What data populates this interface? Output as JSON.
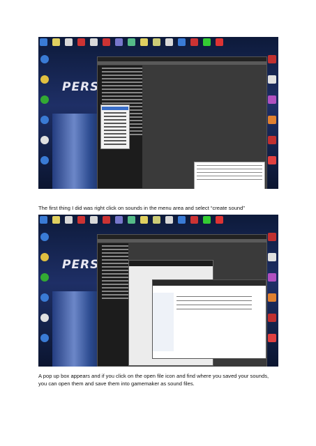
{
  "captions": {
    "first": "The first thing I did was right click on sounds in the menu area and select “create sound”",
    "second_line1": "A pop up box appears and if you click on the open file icon and find where you saved your sounds,",
    "second_line2": "you can open them and save them into gamemaker as sound files."
  },
  "screenshots": [
    {
      "name": "right-click-create-sound",
      "description_tag": "desktop-with-gamemaker-context-menu"
    },
    {
      "name": "open-sound-file-dialog",
      "description_tag": "desktop-with-sound-properties-and-file-browser"
    }
  ],
  "desktop_logo_text": "PERS",
  "colors": {
    "desktop_bg": "#0b1530",
    "app_bg": "#3a3a3a",
    "highlight": "#3a6ec8"
  }
}
